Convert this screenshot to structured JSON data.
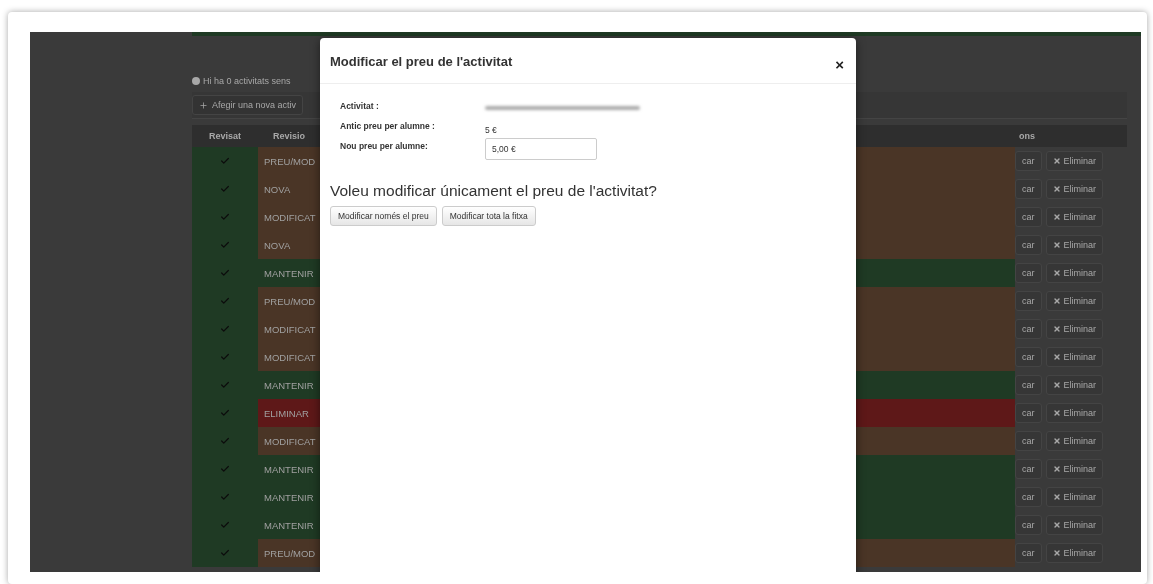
{
  "background": {
    "notice": "Hi ha 0 activitats sens",
    "add_button": "Afegir una nova activ",
    "table": {
      "columns": [
        "Revisat",
        "Revisio",
        "ons"
      ],
      "rows": [
        {
          "revisat": true,
          "status": "PREU/MOD",
          "color": "#4a3526",
          "edit": "car",
          "delete": "Eliminar"
        },
        {
          "revisat": true,
          "status": "NOVA",
          "color": "#4a3526",
          "edit": "car",
          "delete": "Eliminar"
        },
        {
          "revisat": true,
          "status": "MODIFICAT",
          "color": "#4a3526",
          "edit": "car",
          "delete": "Eliminar"
        },
        {
          "revisat": true,
          "status": "NOVA",
          "color": "#4a3526",
          "edit": "car",
          "delete": "Eliminar"
        },
        {
          "revisat": true,
          "status": "MANTENIR",
          "color": "#1f3a24",
          "edit": "car",
          "delete": "Eliminar"
        },
        {
          "revisat": true,
          "status": "PREU/MOD",
          "color": "#4a3526",
          "edit": "car",
          "delete": "Eliminar"
        },
        {
          "revisat": true,
          "status": "MODIFICAT",
          "color": "#4a3526",
          "edit": "car",
          "delete": "Eliminar"
        },
        {
          "revisat": true,
          "status": "MODIFICAT",
          "color": "#4a3526",
          "edit": "car",
          "delete": "Eliminar"
        },
        {
          "revisat": true,
          "status": "MANTENIR",
          "color": "#1f3a24",
          "edit": "car",
          "delete": "Eliminar"
        },
        {
          "revisat": true,
          "status": "ELIMINAR",
          "color": "#5e1818",
          "edit": "car",
          "delete": "Eliminar"
        },
        {
          "revisat": true,
          "status": "MODIFICAT",
          "color": "#4a3526",
          "edit": "car",
          "delete": "Eliminar"
        },
        {
          "revisat": true,
          "status": "MANTENIR",
          "color": "#1f3a24",
          "edit": "car",
          "delete": "Eliminar"
        },
        {
          "revisat": true,
          "status": "MANTENIR",
          "color": "#1f3a24",
          "edit": "car",
          "delete": "Eliminar"
        },
        {
          "revisat": true,
          "status": "MANTENIR",
          "color": "#1f3a24",
          "edit": "car",
          "delete": "Eliminar"
        },
        {
          "revisat": true,
          "status": "PREU/MOD",
          "color": "#4a3526",
          "edit": "car",
          "delete": "Eliminar"
        }
      ]
    }
  },
  "modal": {
    "title": "Modificar el preu de l'activitat",
    "close": "×",
    "fields": [
      {
        "label": "Activitat :",
        "kind": "redacted"
      },
      {
        "label": "Antic preu per alumne :",
        "kind": "text",
        "value": "5 €"
      },
      {
        "label": "Nou preu per alumne:",
        "kind": "input",
        "value": "5,00 €"
      }
    ],
    "question": "Voleu modificar únicament el preu de l'activitat?",
    "buttons": [
      "Modificar només el preu",
      "Modificar tota la fitxa"
    ]
  }
}
